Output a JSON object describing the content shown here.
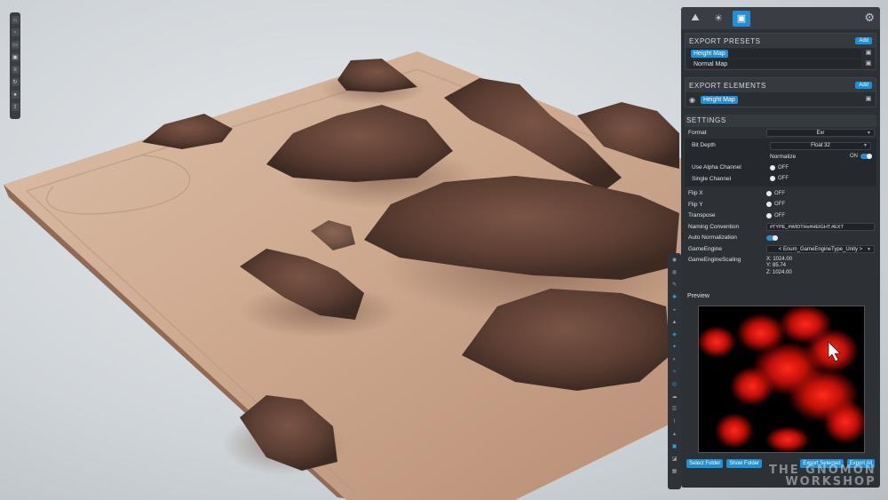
{
  "left_toolbar": {
    "icons": [
      "home-icon",
      "new-file-icon",
      "open-folder-icon",
      "save-icon",
      "document-icon",
      "refresh-icon",
      "camera-icon",
      "export-icon"
    ]
  },
  "panel": {
    "top_tabs": [
      "terrain-icon",
      "sun-icon",
      "save-icon"
    ],
    "export_presets": {
      "title": "EXPORT PRESETS",
      "add_label": "Add",
      "items": [
        {
          "label": "Height Map",
          "selected": true
        },
        {
          "label": "Normal Map",
          "selected": false
        }
      ]
    },
    "export_elements": {
      "title": "EXPORT ELEMENTS",
      "add_label": "Add",
      "items": [
        {
          "label": "Height Map",
          "selected": true
        }
      ]
    },
    "settings": {
      "title": "SETTINGS",
      "format_label": "Format",
      "format_value": "Exr",
      "bit_depth_label": "Bit Depth",
      "bit_depth_value": "Float 32",
      "normalize_label": "Normalize",
      "normalize_state": "ON",
      "alpha_label": "Use Alpha Channel",
      "alpha_state": "OFF",
      "single_label": "Single Channel",
      "single_state": "OFF",
      "flipx_label": "Flip X",
      "flipx_state": "OFF",
      "flipy_label": "Flip Y",
      "flipy_state": "OFF",
      "transpose_label": "Transpose",
      "transpose_state": "OFF",
      "naming_label": "Naming Convention",
      "naming_value": "#TYPE_#WIDTHx#HEIGHT.#EXT",
      "auto_norm_label": "Auto Normalization",
      "auto_norm_state": true,
      "engine_label": "GameEngine",
      "engine_value": "< Enum_GameEngineType_Unity >",
      "scaling_label": "GameEngineScaling",
      "scale_x": "X: 1024.00",
      "scale_y": "Y: 85.74",
      "scale_z": "Z: 1024.00"
    },
    "preview_label": "Preview",
    "buttons": {
      "select_folder": "Select Folder",
      "show_folder": "Show Folder",
      "export_selected": "Export Selected",
      "export_all": "Export All"
    }
  },
  "watermark": {
    "line1": "THE GNOMON",
    "line2": "WORKSHOP"
  },
  "colors": {
    "accent": "#1f8fd6",
    "panel_bg": "#2d3136",
    "sand": "#c9a68f"
  }
}
